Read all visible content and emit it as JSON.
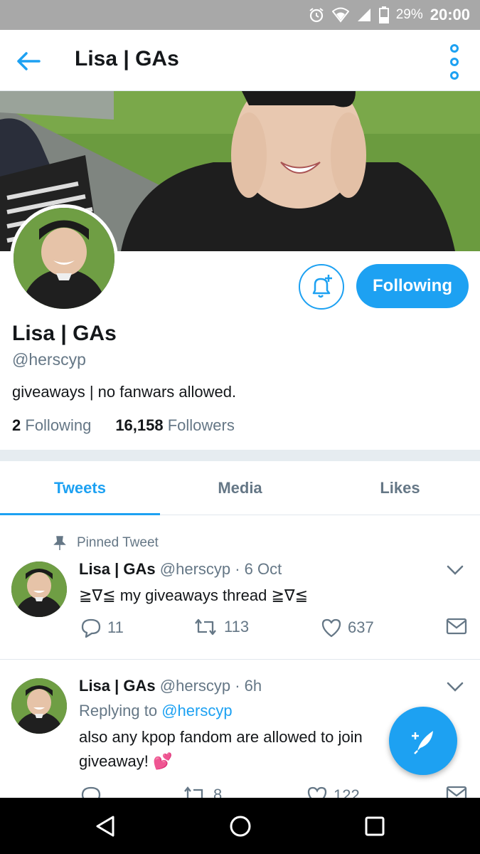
{
  "status_bar": {
    "battery": "29%",
    "time": "20:00",
    "icons": [
      "alarm-icon",
      "wifi-icon",
      "signal-icon",
      "battery-icon"
    ]
  },
  "app_bar": {
    "title": "Lisa | GAs",
    "icons": [
      "back-arrow-icon",
      "more-vertical-icon"
    ]
  },
  "profile": {
    "name": "Lisa | GAs",
    "handle": "@herscyp",
    "bio": "giveaways | no fanwars allowed.",
    "following_count": "2",
    "following_label": "Following",
    "followers_count": "16,158",
    "followers_label": "Followers",
    "follow_button": "Following"
  },
  "tabs": [
    {
      "label": "Tweets",
      "active": true
    },
    {
      "label": "Media",
      "active": false
    },
    {
      "label": "Likes",
      "active": false
    }
  ],
  "tweets": [
    {
      "pinned_label": "Pinned Tweet",
      "name": "Lisa | GAs",
      "meta": "@herscyp · 6 Oct",
      "text": "≧∇≦ my giveaways thread ≧∇≦",
      "replies": "11",
      "retweets": "113",
      "likes": "637"
    },
    {
      "name": "Lisa | GAs",
      "meta": "@herscyp · 6h",
      "reply_prefix": "Replying to",
      "reply_to": "@herscyp",
      "text_line1": "also any kpop fandom are allowed to join",
      "text_line2": "giveaway! 💕",
      "replies": "",
      "retweets": "8",
      "likes": "122"
    }
  ],
  "colors": {
    "accent": "#1da1f2",
    "muted": "#657786",
    "text": "#14171a",
    "status_bar": "#a8a8a8"
  }
}
